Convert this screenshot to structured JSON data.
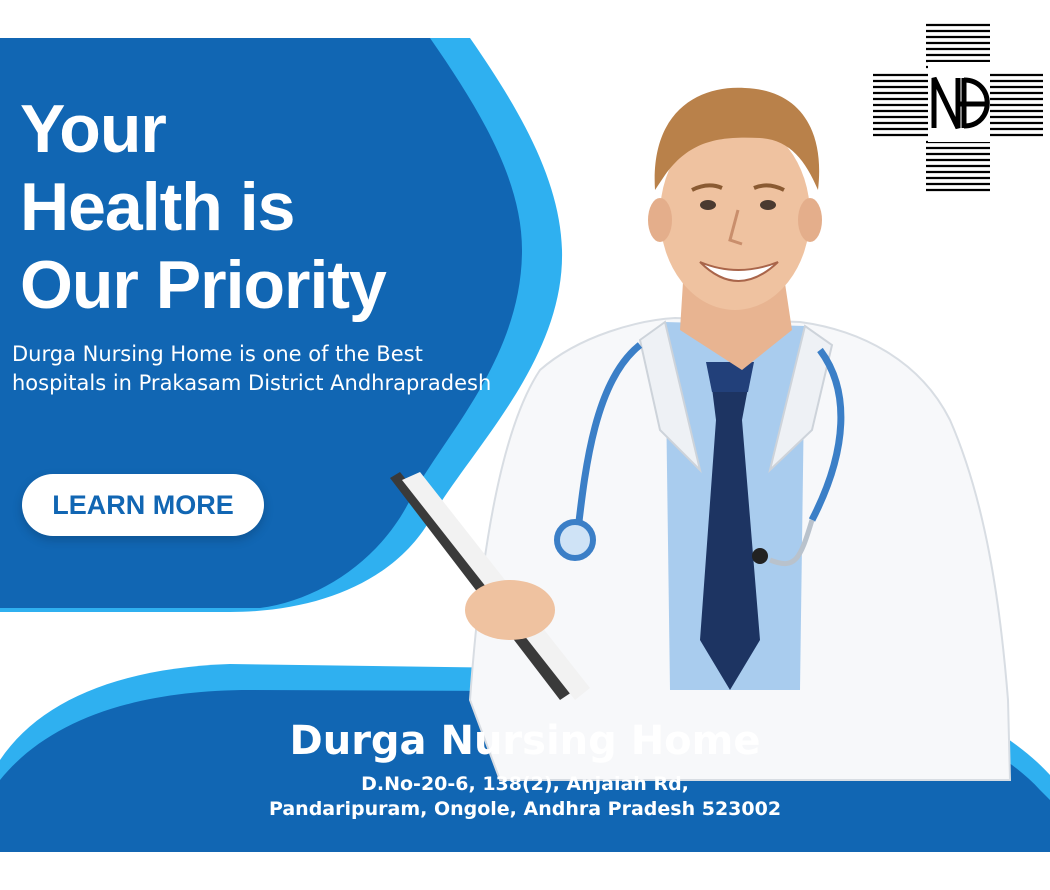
{
  "hero": {
    "headline_lines": [
      "Your",
      "Health is",
      "Our Priority"
    ],
    "description": "Durga Nursing Home is one of the Best hospitals in Prakasam District Andhrapradesh",
    "cta_label": "LEARN MORE"
  },
  "footer": {
    "name": "Durga Nursing Home",
    "address_line1": "D.No-20-6, 138(2), Anjaiah Rd,",
    "address_line2": "Pandaripuram, Ongole, Andhra Pradesh 523002"
  },
  "logo": {
    "icon": "cross-icon",
    "monogram": "NH",
    "style": "striped-cross"
  },
  "photo": {
    "subject": "doctor-illustration"
  },
  "colors": {
    "primary_blue": "#1166b3",
    "light_blue": "#2fb0f0",
    "tie_navy": "#1d3462",
    "coat_white": "#f7f8fa",
    "shirt_blue": "#a9ccee",
    "stethoscope": "#3b7fc7"
  }
}
